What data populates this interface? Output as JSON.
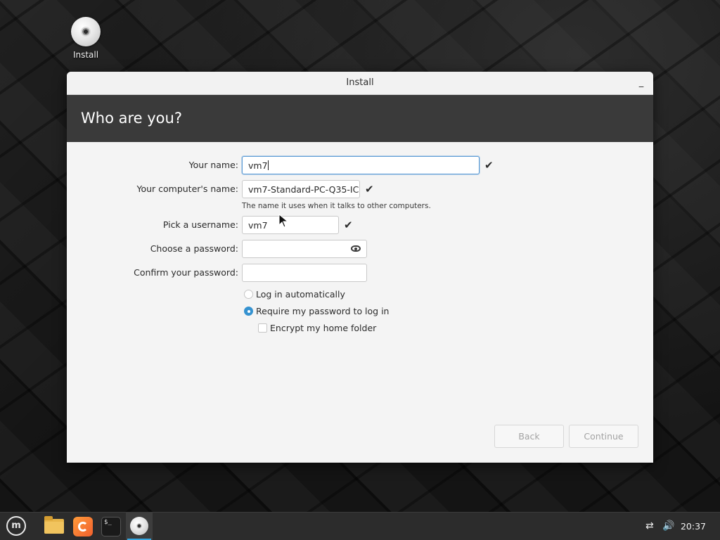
{
  "desktop": {
    "icon_label": "Install"
  },
  "window": {
    "title": "Install",
    "minimize_symbol": "_",
    "header_title": "Who are you?"
  },
  "form": {
    "name": {
      "label": "Your name:",
      "value": "vm7"
    },
    "computer": {
      "label": "Your computer's name:",
      "value": "vm7-Standard-PC-Q35-IC",
      "hint": "The name it uses when it talks to other computers."
    },
    "username": {
      "label": "Pick a username:",
      "value": "vm7"
    },
    "password": {
      "label": "Choose a password:",
      "value": ""
    },
    "confirm": {
      "label": "Confirm your password:",
      "value": ""
    },
    "check_symbol": "✔"
  },
  "options": {
    "login_auto": {
      "label": "Log in automatically",
      "selected": false
    },
    "require_password": {
      "label": "Require my password to log in",
      "selected": true
    },
    "encrypt_home": {
      "label": "Encrypt my home folder",
      "checked": false
    }
  },
  "buttons": {
    "back": "Back",
    "continue": "Continue"
  },
  "taskbar": {
    "menu_glyph": "m",
    "terminal_glyph": "$_",
    "network_glyph": "⇄",
    "volume_glyph": "🔊",
    "clock": "20:37"
  },
  "colors": {
    "accent": "#3592d0",
    "header_bg": "#3a3a3a",
    "taskbar_bg": "#2c2c2c"
  }
}
